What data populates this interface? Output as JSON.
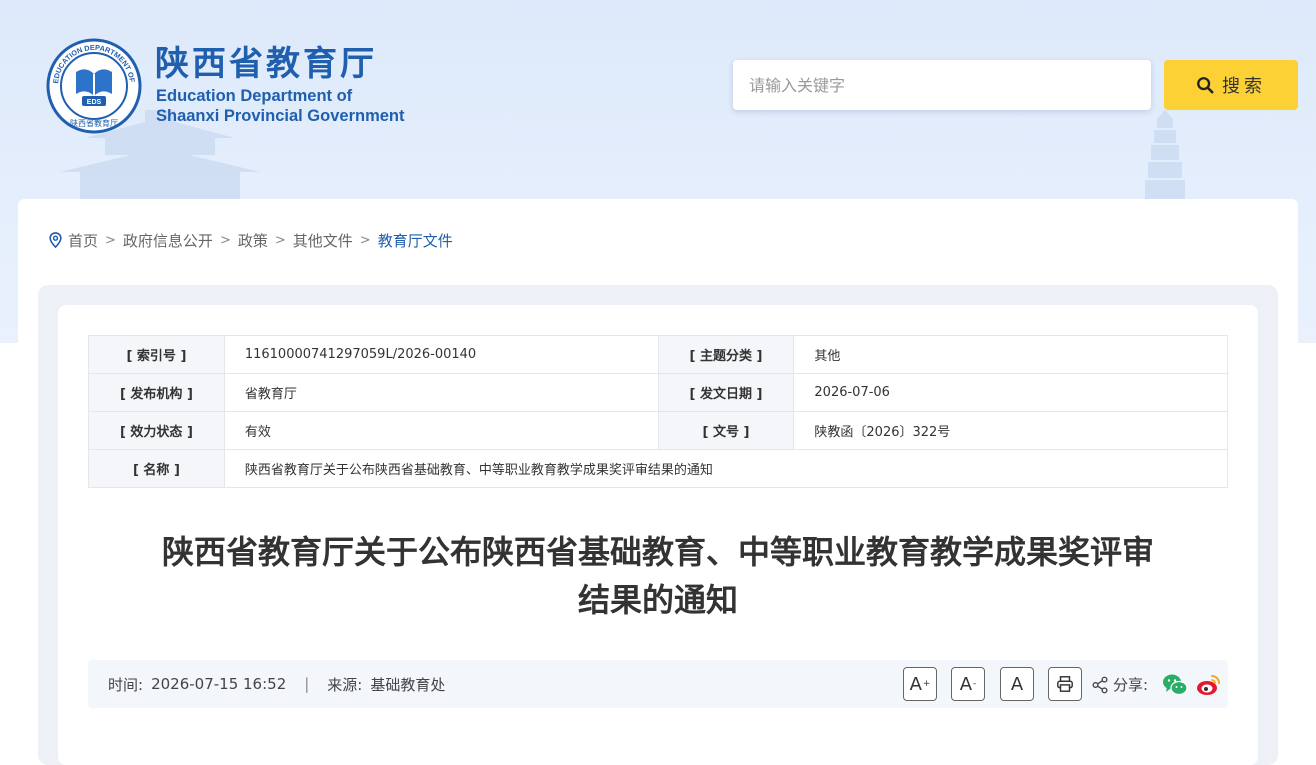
{
  "header": {
    "title_cn": "陕西省教育厅",
    "title_en_line1": "Education Department of",
    "title_en_line2": "Shaanxi Provincial Government",
    "logo_ring_text": "EDUCATION DEPARTMENT OF SHAANXI",
    "logo_center_text": "EDS",
    "logo_bottom_text": "陕西省教育厅"
  },
  "search": {
    "placeholder": "请输入关键字",
    "button_label": "搜索"
  },
  "breadcrumb": {
    "items": [
      "首页",
      "政府信息公开",
      "政策",
      "其他文件",
      "教育厅文件"
    ],
    "separator": ">"
  },
  "meta": {
    "index_no_label": "[ 索引号 ]",
    "index_no": "11610000741297059L/2026-00140",
    "category_label": "[ 主题分类 ]",
    "category": "其他",
    "publisher_label": "[ 发布机构 ]",
    "publisher": "省教育厅",
    "issue_date_label": "[ 发文日期 ]",
    "issue_date": "2026-07-06",
    "status_label": "[ 效力状态 ]",
    "status": "有效",
    "doc_no_label": "[ 文号 ]",
    "doc_no": "陕教函〔2026〕322号",
    "name_label": "[ 名称 ]",
    "name": "陕西省教育厅关于公布陕西省基础教育、中等职业教育教学成果奖评审结果的通知"
  },
  "article": {
    "title_line1": "陕西省教育厅关于公布陕西省基础教育、中等职业教育教学成果奖评审",
    "title_line2": "结果的通知"
  },
  "info": {
    "time_label": "时间:",
    "time": "2026-07-15 16:52",
    "divider": "|",
    "source_label": "来源:",
    "source": "基础教育处",
    "font_large": "A",
    "font_large_mark": "+",
    "font_small": "A",
    "font_small_mark": "-",
    "font_normal": "A",
    "share_label": "分享:"
  },
  "colors": {
    "brand_blue": "#1f5fae",
    "search_button": "#fcd135",
    "status_green": "#1a8a1a",
    "wechat_green": "#2aae67",
    "weibo_red": "#e6162d"
  }
}
